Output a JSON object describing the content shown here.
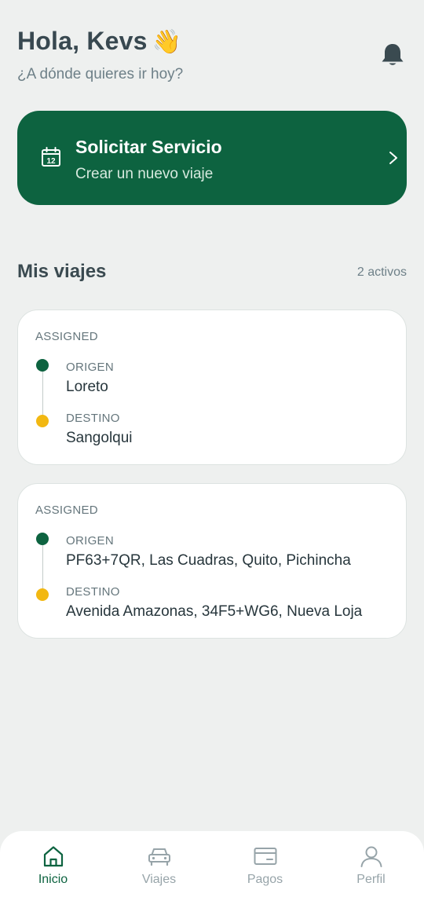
{
  "header": {
    "greeting": "Hola, Kevs",
    "wave_emoji": "👋",
    "subtitle": "¿A dónde quieres ir hoy?",
    "notification_icon": "bell-icon"
  },
  "cta": {
    "icon": "calendar-icon",
    "calendar_day": "12",
    "title": "Solicitar Servicio",
    "subtitle": "Crear un nuevo viaje",
    "chevron_icon": "chevron-right-icon",
    "color": "#0d6340"
  },
  "trips": {
    "title": "Mis viajes",
    "count_label": "2 activos",
    "items": [
      {
        "status": "ASSIGNED",
        "origin_label": "ORIGEN",
        "origin": "Loreto",
        "destination_label": "DESTINO",
        "destination": "Sangolqui"
      },
      {
        "status": "ASSIGNED",
        "origin_label": "ORIGEN",
        "origin": "PF63+7QR, Las Cuadras, Quito, Pichincha",
        "destination_label": "DESTINO",
        "destination": "Avenida Amazonas, 34F5+WG6, Nueva Loja"
      }
    ],
    "origin_color": "#0d6340",
    "destination_color": "#f2b812"
  },
  "nav": {
    "items": [
      {
        "label": "Inicio",
        "icon": "home-icon",
        "active": true
      },
      {
        "label": "Viajes",
        "icon": "car-icon",
        "active": false
      },
      {
        "label": "Pagos",
        "icon": "credit-card-icon",
        "active": false
      },
      {
        "label": "Perfil",
        "icon": "user-icon",
        "active": false
      }
    ],
    "active_color": "#0d6340",
    "inactive_color": "#97a4a9"
  }
}
